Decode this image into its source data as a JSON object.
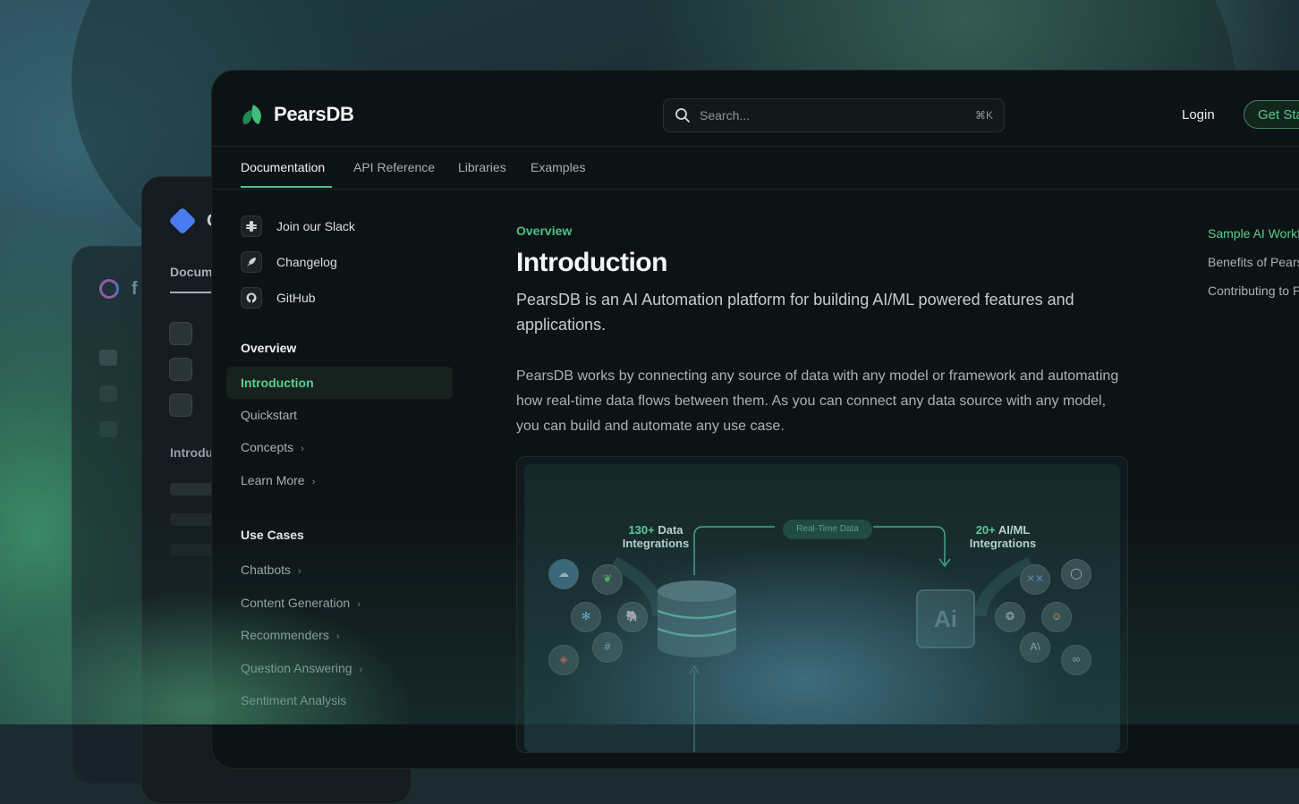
{
  "brand": {
    "name": "PearsDB"
  },
  "search": {
    "placeholder": "Search...",
    "shortcut": "⌘K"
  },
  "header": {
    "login": "Login",
    "get_started": "Get Started"
  },
  "tabs": [
    {
      "label": "Documentation",
      "active": true
    },
    {
      "label": "API Reference"
    },
    {
      "label": "Libraries"
    },
    {
      "label": "Examples"
    }
  ],
  "sidebar": {
    "links": [
      {
        "label": "Join our Slack",
        "icon": "slack-icon"
      },
      {
        "label": "Changelog",
        "icon": "rocket-icon"
      },
      {
        "label": "GitHub",
        "icon": "github-icon"
      }
    ],
    "overview_heading": "Overview",
    "overview_items": [
      {
        "label": "Introduction",
        "active": true
      },
      {
        "label": "Quickstart"
      },
      {
        "label": "Concepts",
        "chevron": "›"
      },
      {
        "label": "Learn More",
        "chevron": "›"
      }
    ],
    "use_cases_heading": "Use Cases",
    "use_case_items": [
      {
        "label": "Chatbots",
        "chevron": "›"
      },
      {
        "label": "Content Generation",
        "chevron": "›"
      },
      {
        "label": "Recommenders",
        "chevron": "›"
      },
      {
        "label": "Question Answering",
        "chevron": "›"
      },
      {
        "label": "Sentiment Analysis"
      }
    ]
  },
  "content": {
    "breadcrumb": "Overview",
    "title": "Introduction",
    "lead": "PearsDB is an AI Automation platform for building AI/ML powered features and applications.",
    "paragraph": "PearsDB works by connecting any source of data with any model or framework and automating how real-time data flows between them. As you can connect any data source with any model, you can build and automate any use case."
  },
  "illustration": {
    "left_count": "130+",
    "left_label_1": "Data",
    "left_label_2": "Integrations",
    "right_count": "20+",
    "right_label_1": "AI/ML",
    "right_label_2": "Integrations",
    "pill": "Real-Time Data",
    "chip": "Ai"
  },
  "toc": [
    {
      "label": "Sample AI Workflows",
      "active": true
    },
    {
      "label": "Benefits of PearsDB"
    },
    {
      "label": "Contributing to PearsDB"
    }
  ],
  "background_windows": {
    "win1_tab": "Documentation",
    "win1_heading": "Introduction"
  },
  "colors": {
    "accent": "#4fbf86",
    "window_bg": "#0d1315"
  }
}
